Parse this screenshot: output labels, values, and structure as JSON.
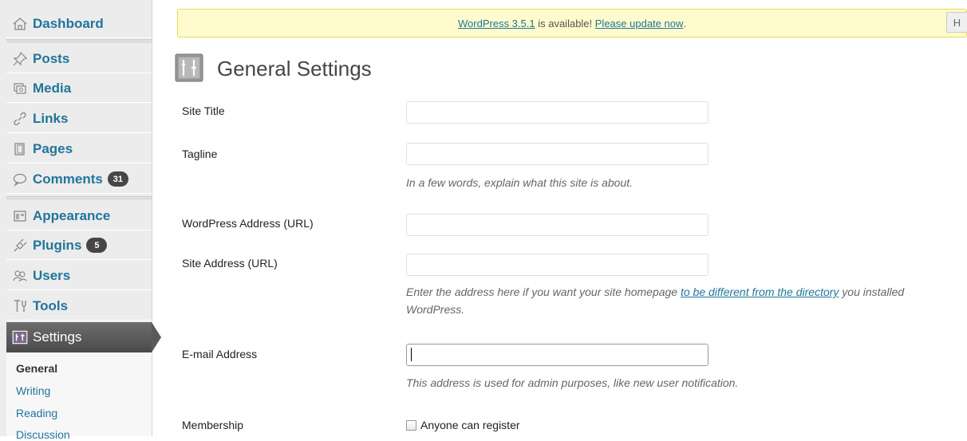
{
  "sidebar": {
    "items": [
      {
        "label": "Dashboard",
        "icon": "dashboard-icon"
      },
      {
        "label": "Posts",
        "icon": "pin-icon"
      },
      {
        "label": "Media",
        "icon": "media-icon"
      },
      {
        "label": "Links",
        "icon": "link-icon"
      },
      {
        "label": "Pages",
        "icon": "pages-icon"
      },
      {
        "label": "Comments",
        "icon": "comment-icon",
        "badge": "31"
      },
      {
        "label": "Appearance",
        "icon": "appearance-icon"
      },
      {
        "label": "Plugins",
        "icon": "plugin-icon",
        "badge": "5"
      },
      {
        "label": "Users",
        "icon": "users-icon"
      },
      {
        "label": "Tools",
        "icon": "tools-icon"
      },
      {
        "label": "Settings",
        "icon": "settings-icon",
        "active": true
      }
    ],
    "submenu": [
      {
        "label": "General",
        "current": true
      },
      {
        "label": "Writing"
      },
      {
        "label": "Reading"
      },
      {
        "label": "Discussion"
      }
    ]
  },
  "notice": {
    "version_link": "WordPress 3.5.1",
    "middle_text": " is available! ",
    "update_link": "Please update now",
    "end_text": "."
  },
  "help_tab": "H",
  "page": {
    "title": "General Settings"
  },
  "form": {
    "site_title": {
      "label": "Site Title",
      "value": ""
    },
    "tagline": {
      "label": "Tagline",
      "value": "",
      "description": "In a few words, explain what this site is about."
    },
    "wp_address": {
      "label": "WordPress Address (URL)",
      "value": ""
    },
    "site_address": {
      "label": "Site Address (URL)",
      "value": "",
      "description_before": "Enter the address here if you want your site homepage ",
      "description_link": "to be different from the directory",
      "description_after": " you installed WordPress."
    },
    "email": {
      "label": "E-mail Address",
      "value": "",
      "description": "This address is used for admin purposes, like new user notification."
    },
    "membership": {
      "label": "Membership",
      "checkbox_label": "Anyone can register",
      "checked": false
    }
  },
  "colors": {
    "link": "#21759b",
    "notice_bg": "#fffbcc",
    "sidebar_bg": "#ececec",
    "active_menu": "#4a4a4a"
  }
}
